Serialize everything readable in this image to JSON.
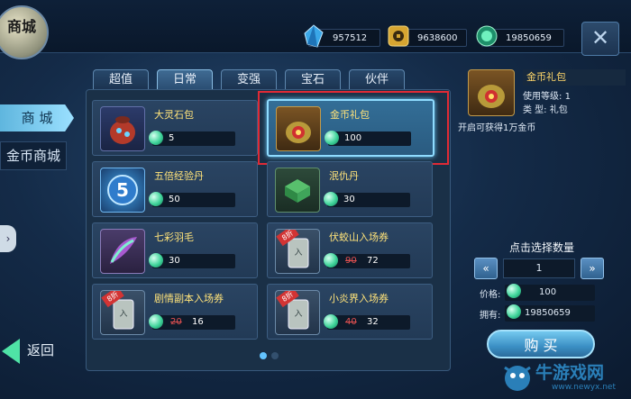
{
  "header": {
    "shop_logo": "商城",
    "currencies": [
      {
        "icon": "blue-crystal-icon",
        "value": "957512"
      },
      {
        "icon": "gold-coin-icon",
        "value": "9638600"
      },
      {
        "icon": "green-gem-icon",
        "value": "19850659"
      }
    ],
    "close_icon": "close-icon"
  },
  "sidebar": {
    "items": [
      {
        "label": "商 城",
        "active": true
      },
      {
        "label": "金币商城",
        "active": false
      }
    ],
    "back_label": "返回"
  },
  "tabs": [
    {
      "label": "超值",
      "active": false
    },
    {
      "label": "日常",
      "active": true
    },
    {
      "label": "变强",
      "active": false
    },
    {
      "label": "宝石",
      "active": false
    },
    {
      "label": "伙伴",
      "active": false
    }
  ],
  "items": [
    {
      "name": "大灵石包",
      "price": "5",
      "old_price": "",
      "selected": false,
      "badge": ""
    },
    {
      "name": "金币礼包",
      "price": "100",
      "old_price": "",
      "selected": true,
      "badge": ""
    },
    {
      "name": "五倍经验丹",
      "price": "50",
      "old_price": "",
      "selected": false,
      "badge": ""
    },
    {
      "name": "泯仇丹",
      "price": "30",
      "old_price": "",
      "selected": false,
      "badge": ""
    },
    {
      "name": "七彩羽毛",
      "price": "30",
      "old_price": "",
      "selected": false,
      "badge": ""
    },
    {
      "name": "伏蛟山入场券",
      "price": "72",
      "old_price": "90",
      "selected": false,
      "badge": "8折"
    },
    {
      "name": "剧情副本入场券",
      "price": "16",
      "old_price": "20",
      "selected": false,
      "badge": "8折"
    },
    {
      "name": "小炎界入场券",
      "price": "32",
      "old_price": "40",
      "selected": false,
      "badge": "8折"
    }
  ],
  "detail": {
    "title": "金币礼包",
    "level_label": "使用等级:",
    "level_value": "1",
    "type_label": "类   型:",
    "type_value": "礼包",
    "description": "开启可获得1万金币"
  },
  "purchase": {
    "select_label": "点击选择数量",
    "quantity": "1",
    "price_label": "价格:",
    "price_value": "100",
    "own_label": "拥有:",
    "own_value": "19850659",
    "buy_label": "购 买"
  },
  "pagination": {
    "pages": 2,
    "current": 1
  },
  "watermark": {
    "text": "牛游戏网",
    "url": "www.newyx.net"
  },
  "colors": {
    "accent": "#8fdcff",
    "highlight_box": "#e02a35",
    "gold_text": "#ffe37a",
    "discount": "#e05050"
  }
}
